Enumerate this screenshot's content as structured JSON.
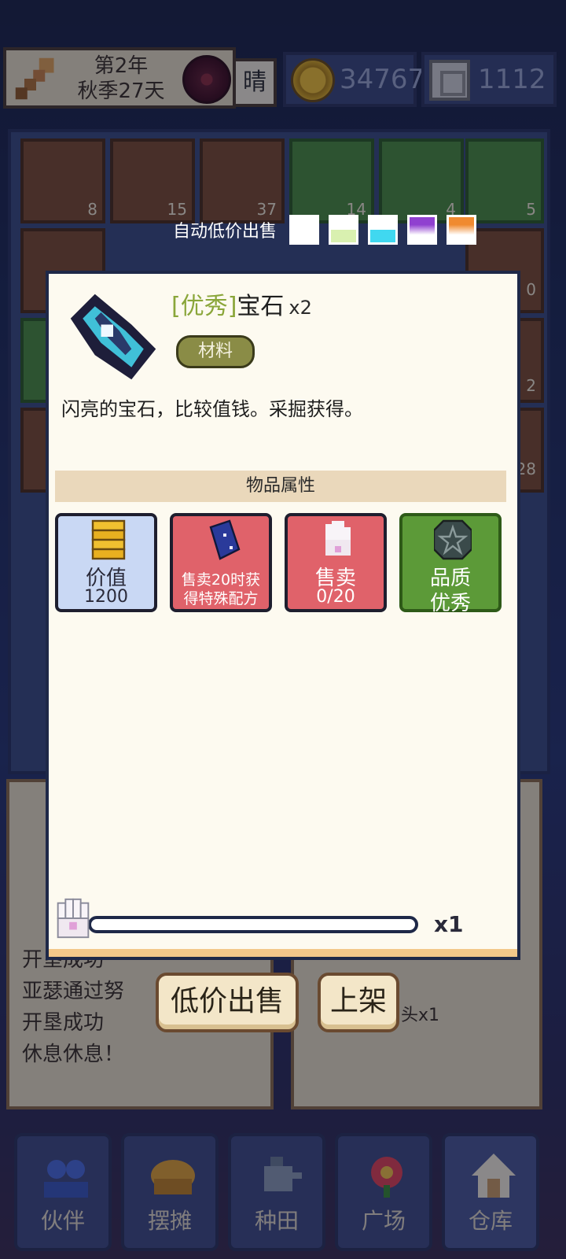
{
  "top_bar": {
    "year": "第2年",
    "season_day": "秋季27天",
    "weather": "晴",
    "gold": "34767",
    "silver": "1112"
  },
  "inventory": {
    "counts": [
      "8",
      "15",
      "37",
      "14",
      "4",
      "5"
    ],
    "right_edge_counts": [
      "0",
      "2",
      "28"
    ]
  },
  "auto_sell": {
    "label": "自动低价出售",
    "swatches": [
      "#ffffff",
      "#d9f0b0",
      "#40d8f0",
      "#9040d0",
      "#f08a30"
    ]
  },
  "item": {
    "quality": "[优秀]",
    "name": "宝石",
    "count": "x2",
    "tag": "材料",
    "description": "闪亮的宝石，比较值钱。采掘获得。",
    "icon": "gem-icon"
  },
  "attributes_title": "物品属性",
  "attributes": [
    {
      "line1": "价值",
      "line2": "1200",
      "icon": "coin-stack-icon"
    },
    {
      "line1": "售卖20时获",
      "line2": "得特殊配方",
      "icon": "book-icon"
    },
    {
      "line1": "售卖",
      "line2": "0/20",
      "icon": "glove-icon"
    },
    {
      "line1": "品质",
      "line2": "优秀",
      "icon": "star-badge-icon"
    }
  ],
  "quantity": {
    "label": "x1",
    "value_fraction": 0.0
  },
  "actions": {
    "sell_low": "低价出售",
    "list": "上架"
  },
  "log": {
    "lines": [
      "开垦成功",
      "亚瑟通过努",
      "开垦成功",
      "休息休息！"
    ],
    "right_line": "头x1"
  },
  "nav": [
    {
      "label": "伙伴",
      "icon": "partner-icon"
    },
    {
      "label": "摆摊",
      "icon": "stall-icon"
    },
    {
      "label": "种田",
      "icon": "farm-icon"
    },
    {
      "label": "广场",
      "icon": "plaza-icon"
    },
    {
      "label": "仓库",
      "icon": "warehouse-icon"
    }
  ]
}
